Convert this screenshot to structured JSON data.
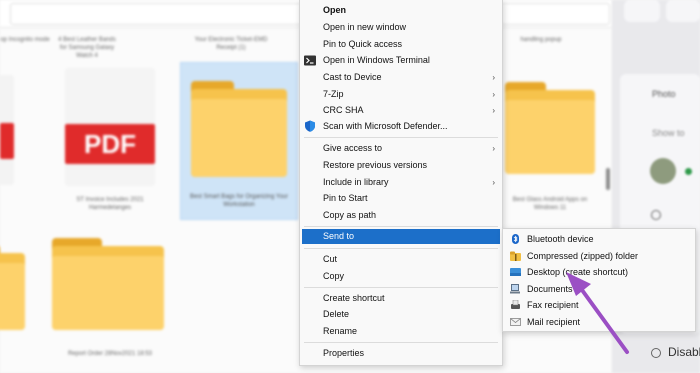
{
  "explorer": {
    "files": [
      {
        "label": "op Incognito mode"
      },
      {
        "label": "4 Best Leather Bands for Samsung Galaxy Watch 4"
      },
      {
        "label": "Your Electronic Ticket-EMD Receipt (1)"
      },
      {
        "label": "Best Smart Bags for Organizing Your Workstation"
      },
      {
        "label": "handling popup"
      },
      {
        "label": "ST Invoice Includes 2021 Harmedelanges"
      },
      {
        "label": "Best Glass Android Apps on Windows 11"
      },
      {
        "label": "Report Order 28Nov2021 18:53"
      }
    ],
    "pdf_badge": "PDF"
  },
  "context_menu": {
    "items": [
      {
        "label": "Open"
      },
      {
        "label": "Open in new window"
      },
      {
        "label": "Pin to Quick access"
      },
      {
        "label": "Open in Windows Terminal"
      },
      {
        "label": "Cast to Device"
      },
      {
        "label": "7-Zip"
      },
      {
        "label": "CRC SHA"
      },
      {
        "label": "Scan with Microsoft Defender..."
      },
      {
        "label": "Give access to"
      },
      {
        "label": "Restore previous versions"
      },
      {
        "label": "Include in library"
      },
      {
        "label": "Pin to Start"
      },
      {
        "label": "Copy as path"
      },
      {
        "label": "Send to"
      },
      {
        "label": "Cut"
      },
      {
        "label": "Copy"
      },
      {
        "label": "Create shortcut"
      },
      {
        "label": "Delete"
      },
      {
        "label": "Rename"
      },
      {
        "label": "Properties"
      }
    ],
    "submenu_arrow": "›"
  },
  "send_to": {
    "items": [
      {
        "label": "Bluetooth device",
        "icon": "bluetooth-icon"
      },
      {
        "label": "Compressed (zipped) folder",
        "icon": "zip-folder-icon"
      },
      {
        "label": "Desktop (create shortcut)",
        "icon": "desktop-icon"
      },
      {
        "label": "Documents",
        "icon": "documents-icon"
      },
      {
        "label": "Fax recipient",
        "icon": "fax-icon"
      },
      {
        "label": "Mail recipient",
        "icon": "mail-icon"
      }
    ]
  },
  "right_pane": {
    "heading": "Photo",
    "subtext": "Show to",
    "disable_label": "Disable"
  },
  "colors": {
    "highlight": "#1c6fc9",
    "annotation_arrow": "#9b4fc4",
    "folder": "#f6c34c"
  }
}
